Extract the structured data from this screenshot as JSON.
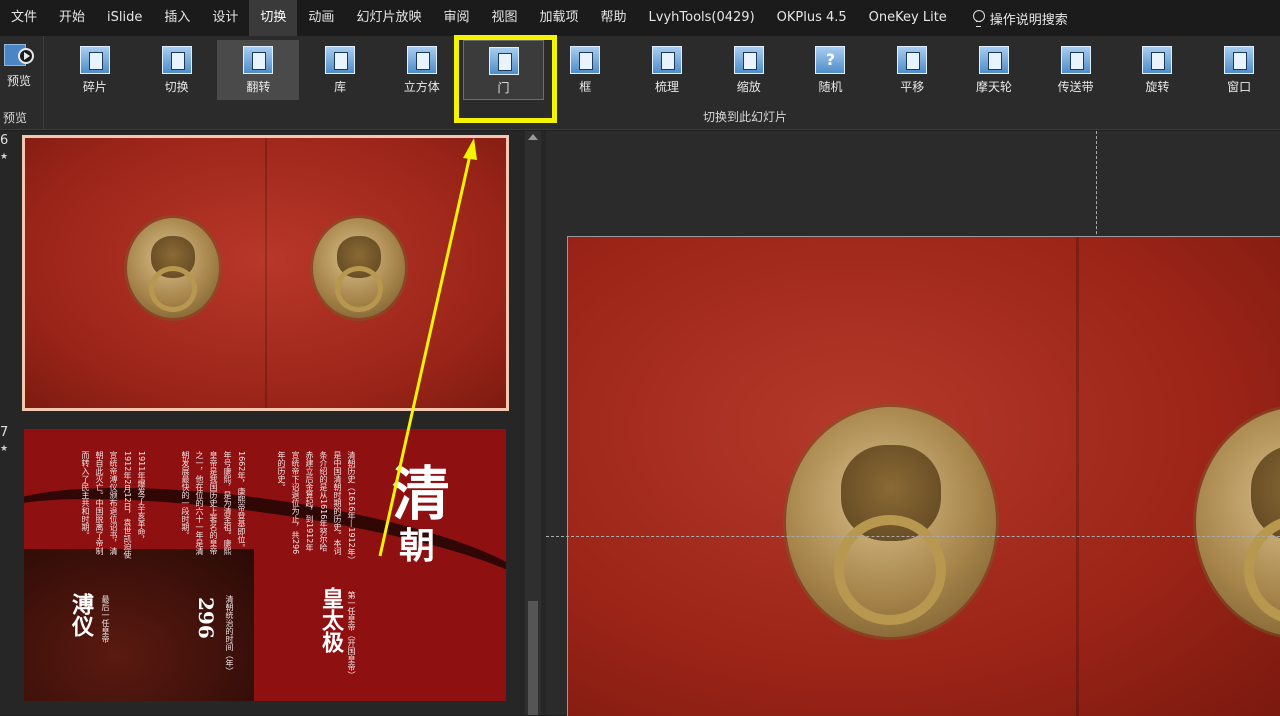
{
  "menu": {
    "tabs": [
      "文件",
      "开始",
      "iSlide",
      "插入",
      "设计",
      "切换",
      "动画",
      "幻灯片放映",
      "审阅",
      "视图",
      "加载项",
      "帮助",
      "LvyhTools(0429)",
      "OKPlus 4.5",
      "OneKey Lite"
    ],
    "active": "切换",
    "search_label": "操作说明搜索"
  },
  "ribbon": {
    "preview_button": "预览",
    "preview_group": "预览",
    "effects": [
      "碎片",
      "切换",
      "翻转",
      "库",
      "立方体",
      "门",
      "框",
      "梳理",
      "缩放",
      "随机",
      "平移",
      "摩天轮",
      "传送带",
      "旋转",
      "窗口"
    ],
    "selected_effect": "翻转",
    "hovered_effect": "门",
    "group_label": "切换到此幻灯片"
  },
  "thumbnails": {
    "slide6_number": "6",
    "slide6_star": "★",
    "slide7_number": "7",
    "slide7_star": "★"
  },
  "slide7": {
    "title_char_1": "清",
    "title_char_2": "朝",
    "col1": "清朝历史（1616年—1912年）",
    "col2": "是中国清朝时期的历史。本词",
    "col3": "条介绍的是从1616年努尔哈",
    "col4": "赤建立后金算起，到1912年",
    "col5": "宣统帝下诏退位为止，共296",
    "col6": "年的历史。",
    "col7": "1662年，康熙帝登基即位。",
    "col8": "年号康熙，是为清圣祖。康熙",
    "col9": "皇帝是我国历史上著名的皇帝",
    "col10": "之一，他在位的六十一年是清",
    "col11": "朝发展最快的一段时期。",
    "col12": "1911年爆发了辛亥革命，",
    "col13": "1912年2月12日，袁世凯迫使",
    "col14": "宣统帝溥仪颁布退位诏书，清",
    "col15": "朝自此灭亡。中国脱离了帝制",
    "col16": "而转入了民主共和时期。",
    "label_first": "第一任皇帝（开国皇帝）",
    "name_first": "皇太极",
    "label_duration": "清朝统治的时间（年）",
    "duration": "296",
    "label_last": "最后一任皇帝",
    "name_last": "溥仪"
  }
}
